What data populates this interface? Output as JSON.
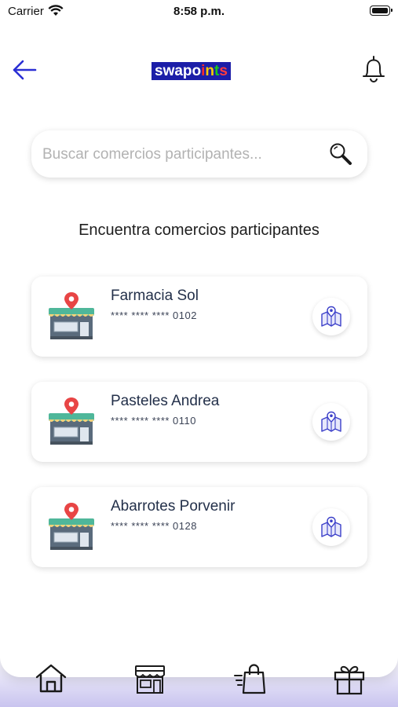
{
  "status_bar": {
    "carrier": "Carrier",
    "time": "8:58 p.m."
  },
  "header": {
    "logo_text": "swapoints"
  },
  "search": {
    "placeholder": "Buscar comercios participantes..."
  },
  "heading": "Encuentra comercios participantes",
  "merchants": [
    {
      "name": "Farmacia Sol",
      "card_number": "**** **** **** 0102"
    },
    {
      "name": "Pasteles Andrea",
      "card_number": "**** **** **** 0110"
    },
    {
      "name": "Abarrotes Porvenir",
      "card_number": "**** **** **** 0128"
    }
  ],
  "tab_bar": {
    "items": [
      "home-icon",
      "store-icon",
      "shopping-bag-icon",
      "gift-icon"
    ]
  },
  "colors": {
    "accent": "#2b2fd4",
    "map_icon": "#3b3fc9",
    "logo_bg": "#1c1ea8",
    "store_awning": "#4fb79a",
    "pin": "#e84545"
  }
}
